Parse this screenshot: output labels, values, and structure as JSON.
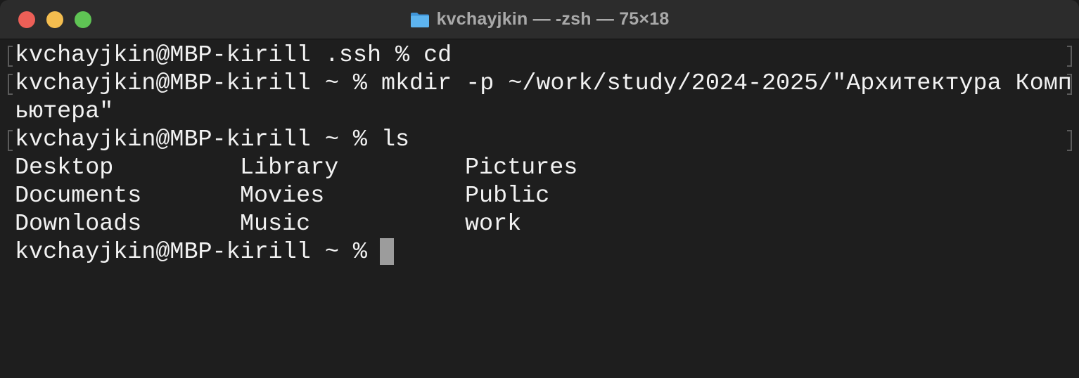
{
  "window": {
    "title": "kvchayjkin — -zsh — 75×18",
    "title_icon": "folder-icon"
  },
  "terminal": {
    "lines": [
      "kvchayjkin@MBP-kirill .ssh % cd",
      "kvchayjkin@MBP-kirill ~ % mkdir -p ~/work/study/2024-2025/\"Архитектура Комп",
      "ьютера\"",
      "kvchayjkin@MBP-kirill ~ % ls"
    ],
    "ls_output": [
      [
        "Desktop",
        "Library",
        "Pictures"
      ],
      [
        "Documents",
        "Movies",
        "Public"
      ],
      [
        "Downloads",
        "Music",
        "work"
      ]
    ],
    "prompt": "kvchayjkin@MBP-kirill ~ % "
  },
  "colors": {
    "background": "#1e1e1e",
    "text": "#f2f2f2",
    "cursor": "#9c9c9c",
    "titlebar": "#2c2c2c",
    "close": "#ec5f57",
    "minimize": "#f4bd4f",
    "maximize": "#5fc454",
    "folder": "#4aa6e8"
  }
}
